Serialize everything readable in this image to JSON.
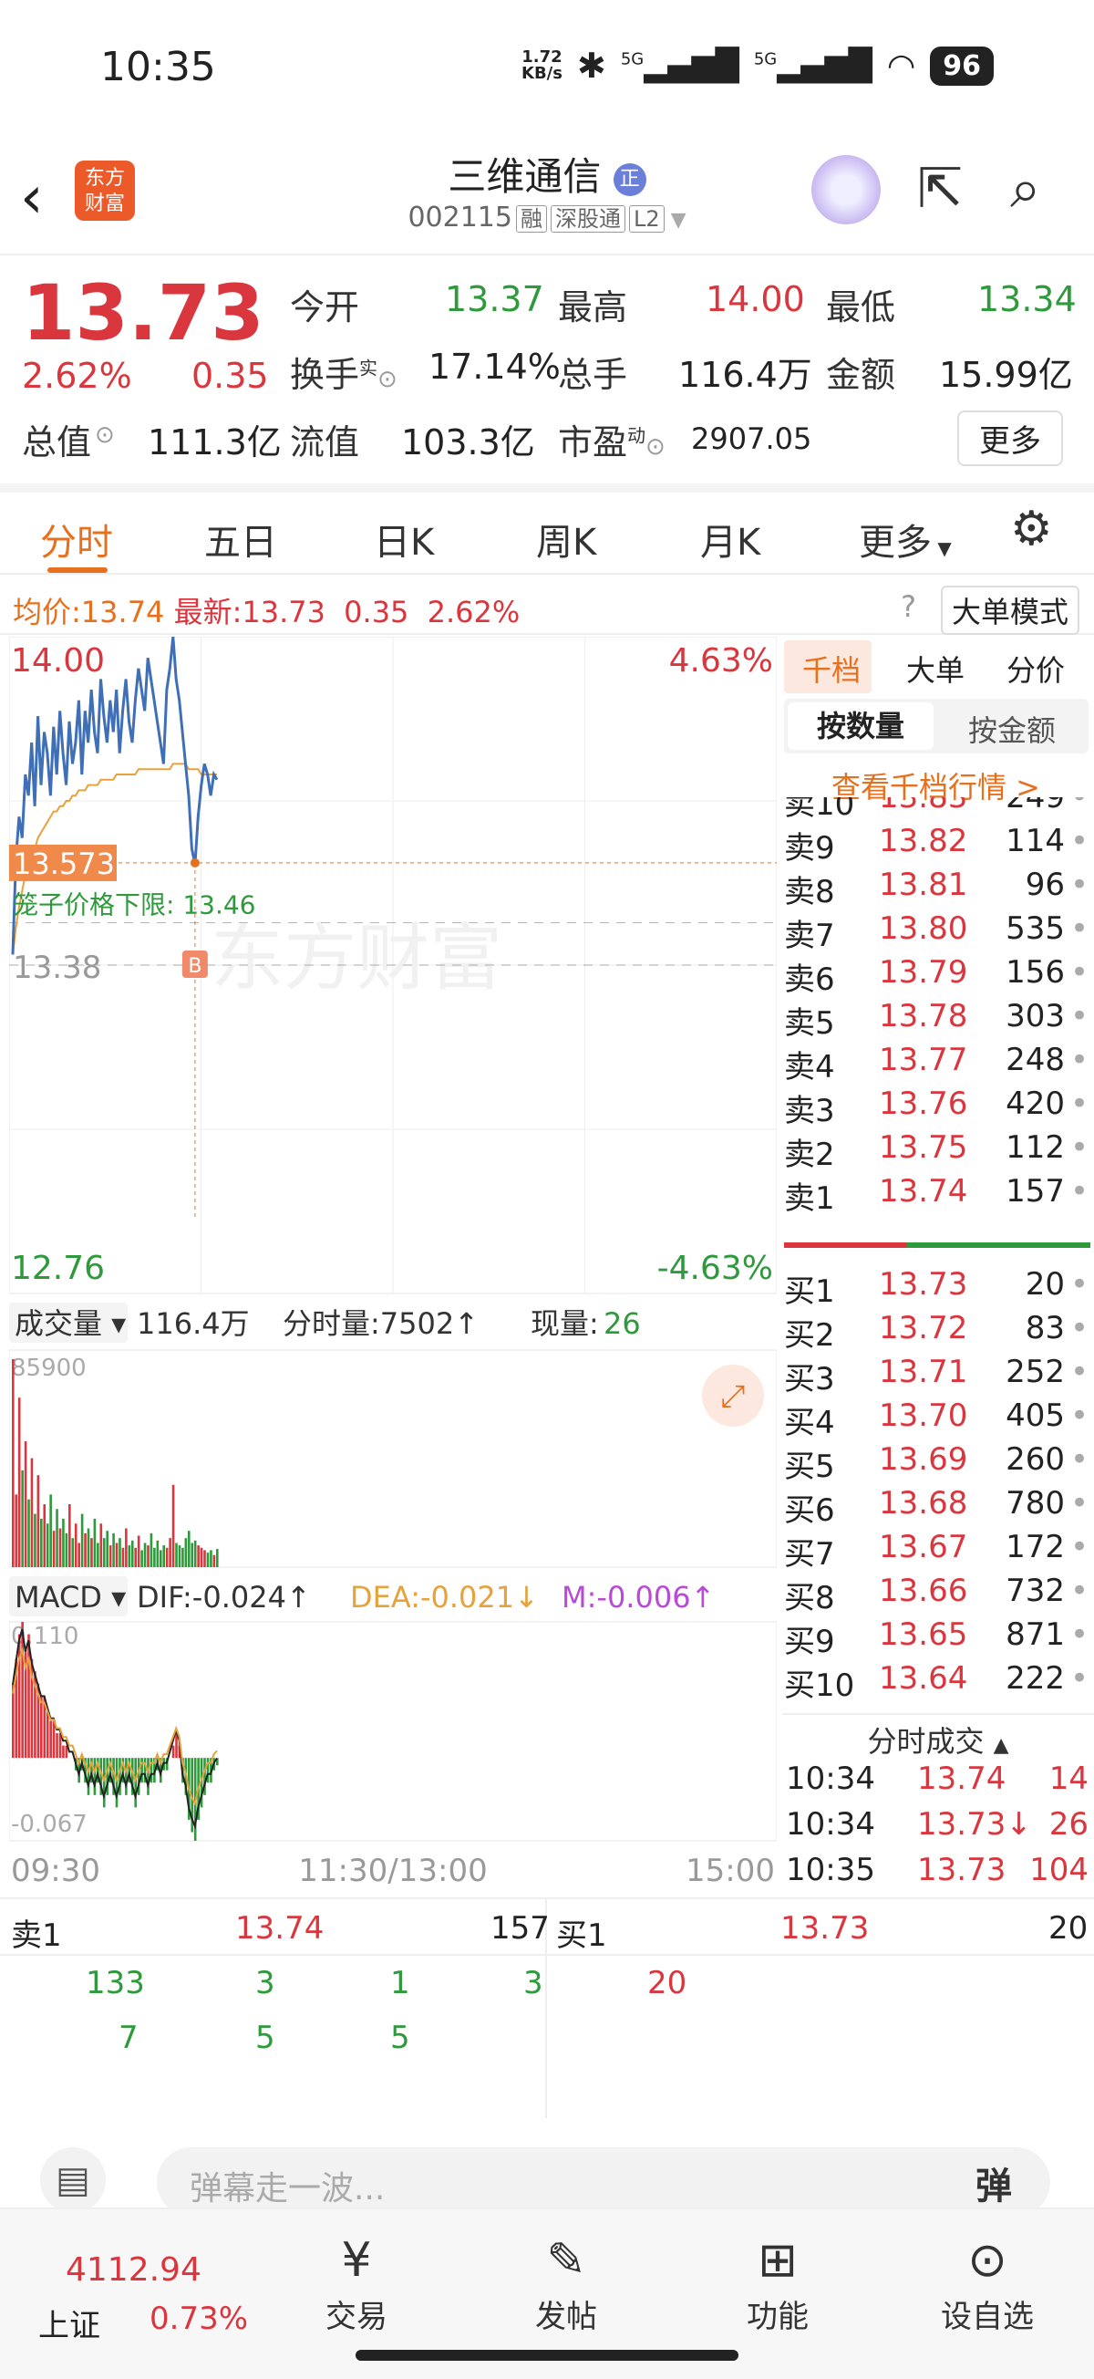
{
  "status": {
    "time": "10:35",
    "speed": "1.72\nKB/s",
    "net1": "5G",
    "net2": "5G",
    "battery": "96"
  },
  "header": {
    "logo": "东方财富",
    "name": "三维通信",
    "badge": "正",
    "code": "002115",
    "tags": [
      "融",
      "深股通",
      "L2"
    ]
  },
  "quote": {
    "price": "13.73",
    "change_pct": "2.62%",
    "change": "0.35",
    "open_label": "今开",
    "open": "13.37",
    "high_label": "最高",
    "high": "14.00",
    "low_label": "最低",
    "low": "13.34",
    "turnover_label": "换手",
    "turnover_sup": "实",
    "turnover": "17.14%",
    "volume_label": "总手",
    "volume": "116.4万",
    "amount_label": "金额",
    "amount": "15.99亿",
    "mcap_label": "总值",
    "mcap": "111.3亿",
    "float_label": "流值",
    "float": "103.3亿",
    "pe_label": "市盈",
    "pe_sup": "动",
    "pe": "2907.05",
    "more": "更多"
  },
  "tabs": [
    "分时",
    "五日",
    "日K",
    "周K",
    "月K",
    "更多"
  ],
  "avg": {
    "label": "均价:",
    "value": "13.74",
    "latest_label": "最新:",
    "latest": "13.73",
    "chg": "0.35",
    "pct": "2.62%",
    "mode": "大单模式"
  },
  "chart": {
    "y_top": "14.00",
    "pct_top": "4.63%",
    "y_bottom": "12.76",
    "pct_bottom": "-4.63%",
    "cursor_price": "13.573",
    "cage_label": "笼子价格下限:",
    "cage_value": "13.46",
    "ref_price": "13.38",
    "buy_marker": "B",
    "watermark": "东方财富",
    "vol_label": "成交量",
    "vol_total": "116.4万",
    "min_vol_label": "分时量:",
    "min_vol": "7502↑",
    "cur_vol_label": "现量:",
    "cur_vol": "26",
    "vol_max": "85900",
    "macd_label": "MACD",
    "dif": "DIF:-0.024↑",
    "dea": "DEA:-0.021↓",
    "m": "M:-0.006↑",
    "macd_top": "0.110",
    "macd_bottom": "-0.067",
    "x_labels": [
      "09:30",
      "11:30/13:00",
      "15:00"
    ]
  },
  "chart_data": {
    "type": "line",
    "x": [
      "09:30",
      "09:31",
      "09:32",
      "09:33",
      "09:34",
      "09:35",
      "09:36",
      "09:37",
      "09:38",
      "09:39",
      "09:40",
      "09:41",
      "09:42",
      "09:43",
      "09:44",
      "09:45",
      "09:46",
      "09:47",
      "09:48",
      "09:49",
      "09:50",
      "09:51",
      "09:52",
      "09:53",
      "09:54",
      "09:55",
      "09:56",
      "09:57",
      "09:58",
      "09:59",
      "10:00",
      "10:01",
      "10:02",
      "10:03",
      "10:04",
      "10:05",
      "10:06",
      "10:07",
      "10:08",
      "10:09",
      "10:10",
      "10:11",
      "10:12",
      "10:13",
      "10:14",
      "10:15",
      "10:16",
      "10:17",
      "10:18",
      "10:19",
      "10:20",
      "10:21",
      "10:22",
      "10:23",
      "10:24",
      "10:25",
      "10:26",
      "10:27",
      "10:28",
      "10:29",
      "10:30",
      "10:31",
      "10:32",
      "10:33",
      "10:34",
      "10:35"
    ],
    "series": [
      {
        "name": "价格",
        "values": [
          13.4,
          13.58,
          13.66,
          13.62,
          13.74,
          13.7,
          13.8,
          13.68,
          13.85,
          13.72,
          13.82,
          13.78,
          13.7,
          13.83,
          13.74,
          13.86,
          13.78,
          13.72,
          13.84,
          13.76,
          13.8,
          13.88,
          13.74,
          13.86,
          13.8,
          13.9,
          13.82,
          13.78,
          13.92,
          13.85,
          13.8,
          13.88,
          13.82,
          13.9,
          13.78,
          13.86,
          13.92,
          13.84,
          13.8,
          13.88,
          13.94,
          13.9,
          13.86,
          13.96,
          13.92,
          13.88,
          13.84,
          13.8,
          13.76,
          13.9,
          13.94,
          14.0,
          13.92,
          13.88,
          13.82,
          13.76,
          13.7,
          13.6,
          13.57,
          13.66,
          13.72,
          13.76,
          13.74,
          13.7,
          13.74,
          13.73
        ]
      },
      {
        "name": "均价",
        "values": [
          13.4,
          13.45,
          13.49,
          13.52,
          13.55,
          13.57,
          13.59,
          13.6,
          13.62,
          13.63,
          13.64,
          13.65,
          13.66,
          13.67,
          13.67,
          13.68,
          13.68,
          13.69,
          13.69,
          13.7,
          13.7,
          13.71,
          13.71,
          13.71,
          13.72,
          13.72,
          13.72,
          13.72,
          13.73,
          13.73,
          13.73,
          13.73,
          13.73,
          13.74,
          13.74,
          13.74,
          13.74,
          13.74,
          13.74,
          13.74,
          13.75,
          13.75,
          13.75,
          13.75,
          13.75,
          13.75,
          13.75,
          13.75,
          13.75,
          13.75,
          13.75,
          13.76,
          13.76,
          13.76,
          13.76,
          13.76,
          13.75,
          13.75,
          13.75,
          13.75,
          13.74,
          13.74,
          13.74,
          13.74,
          13.74,
          13.74
        ]
      }
    ],
    "ylim": [
      12.76,
      14.0
    ],
    "prev_close": 13.38,
    "volumes": [
      85900,
      30000,
      70000,
      40000,
      52000,
      28000,
      45000,
      22000,
      38000,
      20000,
      26000,
      18000,
      30000,
      15000,
      24000,
      16000,
      20000,
      14000,
      26000,
      12000,
      18000,
      10000,
      22000,
      14000,
      16000,
      12000,
      20000,
      10000,
      18000,
      12000,
      15000,
      9000,
      14000,
      10000,
      12000,
      8000,
      16000,
      9000,
      11000,
      8000,
      13000,
      7000,
      10000,
      9000,
      14000,
      8000,
      11000,
      7000,
      9000,
      8000,
      12000,
      34000,
      10000,
      9000,
      8000,
      12000,
      15000,
      10000,
      11000,
      9000,
      8000,
      7000,
      6000,
      7000,
      5000,
      7502
    ],
    "macd_hist": [
      0.06,
      0.08,
      0.1,
      0.11,
      0.09,
      0.1,
      0.08,
      0.07,
      0.06,
      0.05,
      0.05,
      0.04,
      0.03,
      0.03,
      0.02,
      0.02,
      0.01,
      0.01,
      0.0,
      0.0,
      -0.01,
      -0.02,
      -0.01,
      -0.02,
      -0.03,
      -0.02,
      -0.03,
      -0.02,
      -0.03,
      -0.04,
      -0.03,
      -0.02,
      -0.03,
      -0.04,
      -0.03,
      -0.02,
      -0.03,
      -0.02,
      -0.03,
      -0.04,
      -0.03,
      -0.02,
      -0.02,
      -0.03,
      -0.02,
      -0.02,
      -0.01,
      -0.02,
      -0.01,
      -0.01,
      0.0,
      0.01,
      0.02,
      0.01,
      -0.02,
      -0.03,
      -0.05,
      -0.06,
      -0.067,
      -0.05,
      -0.04,
      -0.03,
      -0.02,
      -0.02,
      -0.01,
      -0.006
    ]
  },
  "book": {
    "tabs": [
      "千档",
      "大单",
      "分价"
    ],
    "sub_tabs": [
      "按数量",
      "按金额"
    ],
    "link": "查看千档行情 >",
    "asks": [
      {
        "label": "卖10",
        "price": "13.83",
        "vol": "249"
      },
      {
        "label": "卖9",
        "price": "13.82",
        "vol": "114"
      },
      {
        "label": "卖8",
        "price": "13.81",
        "vol": "96"
      },
      {
        "label": "卖7",
        "price": "13.80",
        "vol": "535"
      },
      {
        "label": "卖6",
        "price": "13.79",
        "vol": "156"
      },
      {
        "label": "卖5",
        "price": "13.78",
        "vol": "303"
      },
      {
        "label": "卖4",
        "price": "13.77",
        "vol": "248"
      },
      {
        "label": "卖3",
        "price": "13.76",
        "vol": "420"
      },
      {
        "label": "卖2",
        "price": "13.75",
        "vol": "112"
      },
      {
        "label": "卖1",
        "price": "13.74",
        "vol": "157"
      }
    ],
    "bids": [
      {
        "label": "买1",
        "price": "13.73",
        "vol": "20"
      },
      {
        "label": "买2",
        "price": "13.72",
        "vol": "83"
      },
      {
        "label": "买3",
        "price": "13.71",
        "vol": "252"
      },
      {
        "label": "买4",
        "price": "13.70",
        "vol": "405"
      },
      {
        "label": "买5",
        "price": "13.69",
        "vol": "260"
      },
      {
        "label": "买6",
        "price": "13.68",
        "vol": "780"
      },
      {
        "label": "买7",
        "price": "13.67",
        "vol": "172"
      },
      {
        "label": "买8",
        "price": "13.66",
        "vol": "732"
      },
      {
        "label": "买9",
        "price": "13.65",
        "vol": "871"
      },
      {
        "label": "买10",
        "price": "13.64",
        "vol": "222"
      }
    ],
    "trades_label": "分时成交",
    "trades": [
      {
        "time": "10:34",
        "price": "13.74",
        "vol": "14"
      },
      {
        "time": "10:34",
        "price": "13.73↓",
        "vol": "26"
      },
      {
        "time": "10:35",
        "price": "13.73",
        "vol": "104"
      }
    ]
  },
  "detail": {
    "ask_label": "卖1",
    "ask_price": "13.74",
    "ask_vol": "157",
    "bid_label": "买1",
    "bid_price": "13.73",
    "bid_vol": "20",
    "ask_queue_row1": [
      "133",
      "3",
      "1",
      "3"
    ],
    "ask_queue_row2": [
      "7",
      "5",
      "5"
    ],
    "bid_queue_row1": [
      "20"
    ]
  },
  "danmu": {
    "placeholder": "弹幕走一波...",
    "btn": "弹"
  },
  "nav": {
    "index_value": "4112.94",
    "index_name": "上证",
    "index_pct": "0.73%",
    "items": [
      "交易",
      "发帖",
      "功能",
      "设自选"
    ]
  }
}
